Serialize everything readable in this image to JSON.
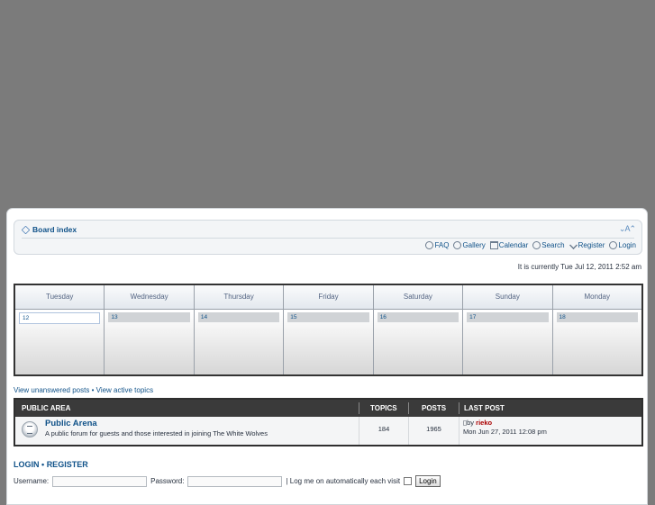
{
  "nav": {
    "board_index": "Board index",
    "resize_glyph": "⌄A⌃",
    "links": {
      "faq": "FAQ",
      "gallery": "Gallery",
      "calendar": "Calendar",
      "search": "Search",
      "register": "Register",
      "login": "Login"
    }
  },
  "current_time": "It is currently Tue Jul 12, 2011 2:52 am",
  "calendar": {
    "days": [
      {
        "name": "Tuesday",
        "num": "12"
      },
      {
        "name": "Wednesday",
        "num": "13"
      },
      {
        "name": "Thursday",
        "num": "14"
      },
      {
        "name": "Friday",
        "num": "15"
      },
      {
        "name": "Saturday",
        "num": "16"
      },
      {
        "name": "Sunday",
        "num": "17"
      },
      {
        "name": "Monday",
        "num": "18"
      }
    ]
  },
  "quick_links": {
    "unanswered": "View unanswered posts",
    "separator": "•",
    "active": "View active topics"
  },
  "forum_table": {
    "headers": {
      "area": "PUBLIC AREA",
      "topics": "TOPICS",
      "posts": "POSTS",
      "last_post": "LAST POST"
    },
    "row": {
      "title": "Public Arena",
      "description": "A public forum for guests and those interested in joining The White Wolves",
      "topics": "184",
      "posts": "1965",
      "last_post_by": "by",
      "last_post_author": "rieko",
      "last_post_date": "Mon Jun 27, 2011 12:08 pm"
    }
  },
  "login": {
    "login_link": "LOGIN",
    "separator": "•",
    "register_link": "REGISTER",
    "username_label": "Username:",
    "password_label": "Password:",
    "auto_label": "| Log me on automatically each visit",
    "button": "Login"
  }
}
